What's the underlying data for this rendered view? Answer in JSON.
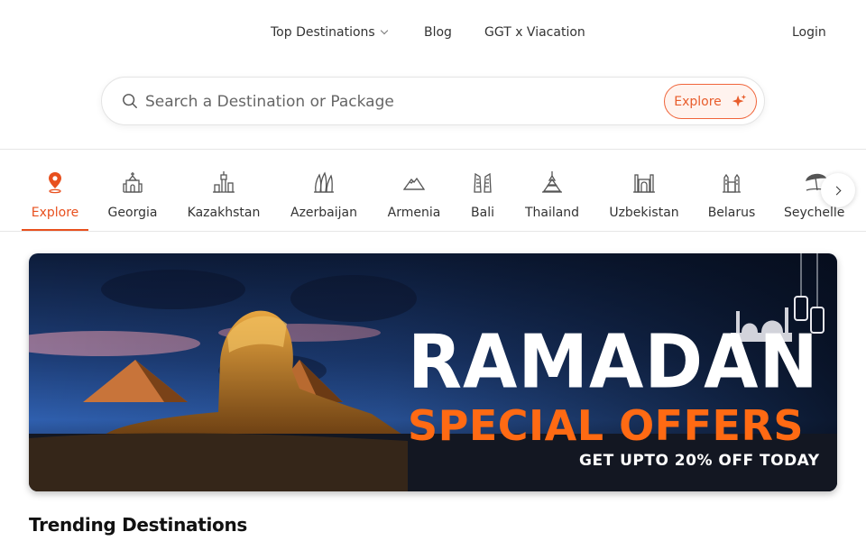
{
  "nav": {
    "top_destinations": "Top Destinations",
    "blog": "Blog",
    "ggt": "GGT x Viacation",
    "login": "Login"
  },
  "search": {
    "placeholder": "Search a Destination or Package",
    "explore_label": "Explore"
  },
  "categories": [
    {
      "label": "Explore",
      "icon": "location-pin-icon",
      "active": true
    },
    {
      "label": "Georgia",
      "icon": "church-icon"
    },
    {
      "label": "Kazakhstan",
      "icon": "tower-icon"
    },
    {
      "label": "Azerbaijan",
      "icon": "flame-towers-icon"
    },
    {
      "label": "Armenia",
      "icon": "mountain-icon"
    },
    {
      "label": "Bali",
      "icon": "temple-gate-icon"
    },
    {
      "label": "Thailand",
      "icon": "pagoda-icon"
    },
    {
      "label": "Uzbekistan",
      "icon": "mosque-icon"
    },
    {
      "label": "Belarus",
      "icon": "castle-icon"
    },
    {
      "label": "Seychelle",
      "icon": "beach-umbrella-icon"
    }
  ],
  "banner": {
    "title": "RAMADAN",
    "subtitle": "SPECIAL OFFERS",
    "offer": "GET UPTO 20% OFF TODAY"
  },
  "trending": {
    "title": "Trending Destinations"
  },
  "colors": {
    "accent": "#e8501e",
    "offer_orange": "#ff6a13"
  }
}
